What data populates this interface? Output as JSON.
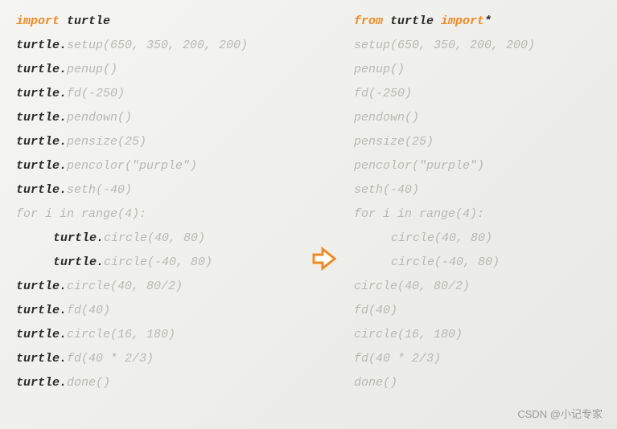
{
  "left": {
    "l01": {
      "kw": "import ",
      "mod": "turtle"
    },
    "l02": {
      "pre": "turtle.",
      "rest": "setup(650, 350, 200, 200)"
    },
    "l03": {
      "pre": "turtle.",
      "rest": "penup()"
    },
    "l04": {
      "pre": "turtle.",
      "rest": "fd(-250)"
    },
    "l05": {
      "pre": "turtle.",
      "rest": "pendown()"
    },
    "l06": {
      "pre": "turtle.",
      "rest": "pensize(25)"
    },
    "l07": {
      "pre": "turtle.",
      "rest": "pencolor(\"purple\")"
    },
    "l08": {
      "pre": "turtle.",
      "rest": "seth(-40)"
    },
    "l09": {
      "dimpre": "for i in ",
      "dimrest": "range(4):"
    },
    "l10": {
      "pre": "turtle.",
      "rest": "circle(40, 80)"
    },
    "l11": {
      "pre": "turtle.",
      "rest": "circle(-40, 80)"
    },
    "l12": {
      "pre": "turtle.",
      "rest": "circle(40, 80/2)"
    },
    "l13": {
      "pre": "turtle.",
      "rest": "fd(40)"
    },
    "l14": {
      "pre": "turtle.",
      "rest": "circle(16, 180)"
    },
    "l15": {
      "pre": "turtle.",
      "rest": "fd(40 * 2/3)"
    },
    "l16": {
      "pre": "turtle.",
      "rest": "done()"
    }
  },
  "right": {
    "l01": {
      "kw1": "from ",
      "mod": "turtle ",
      "kw2": "import",
      "star": "*"
    },
    "l02": "setup(650, 350, 200, 200)",
    "l03": "penup()",
    "l04": "fd(-250)",
    "l05": "pendown()",
    "l06": "pensize(25)",
    "l07": "pencolor(\"purple\")",
    "l08": "seth(-40)",
    "l09": "for i in range(4):",
    "l10": "circle(40, 80)",
    "l11": "circle(-40, 80)",
    "l12": "circle(40, 80/2)",
    "l13": "fd(40)",
    "l14": "circle(16, 180)",
    "l15": "fd(40 * 2/3)",
    "l16": "done()"
  },
  "watermark": "CSDN @小记专家"
}
